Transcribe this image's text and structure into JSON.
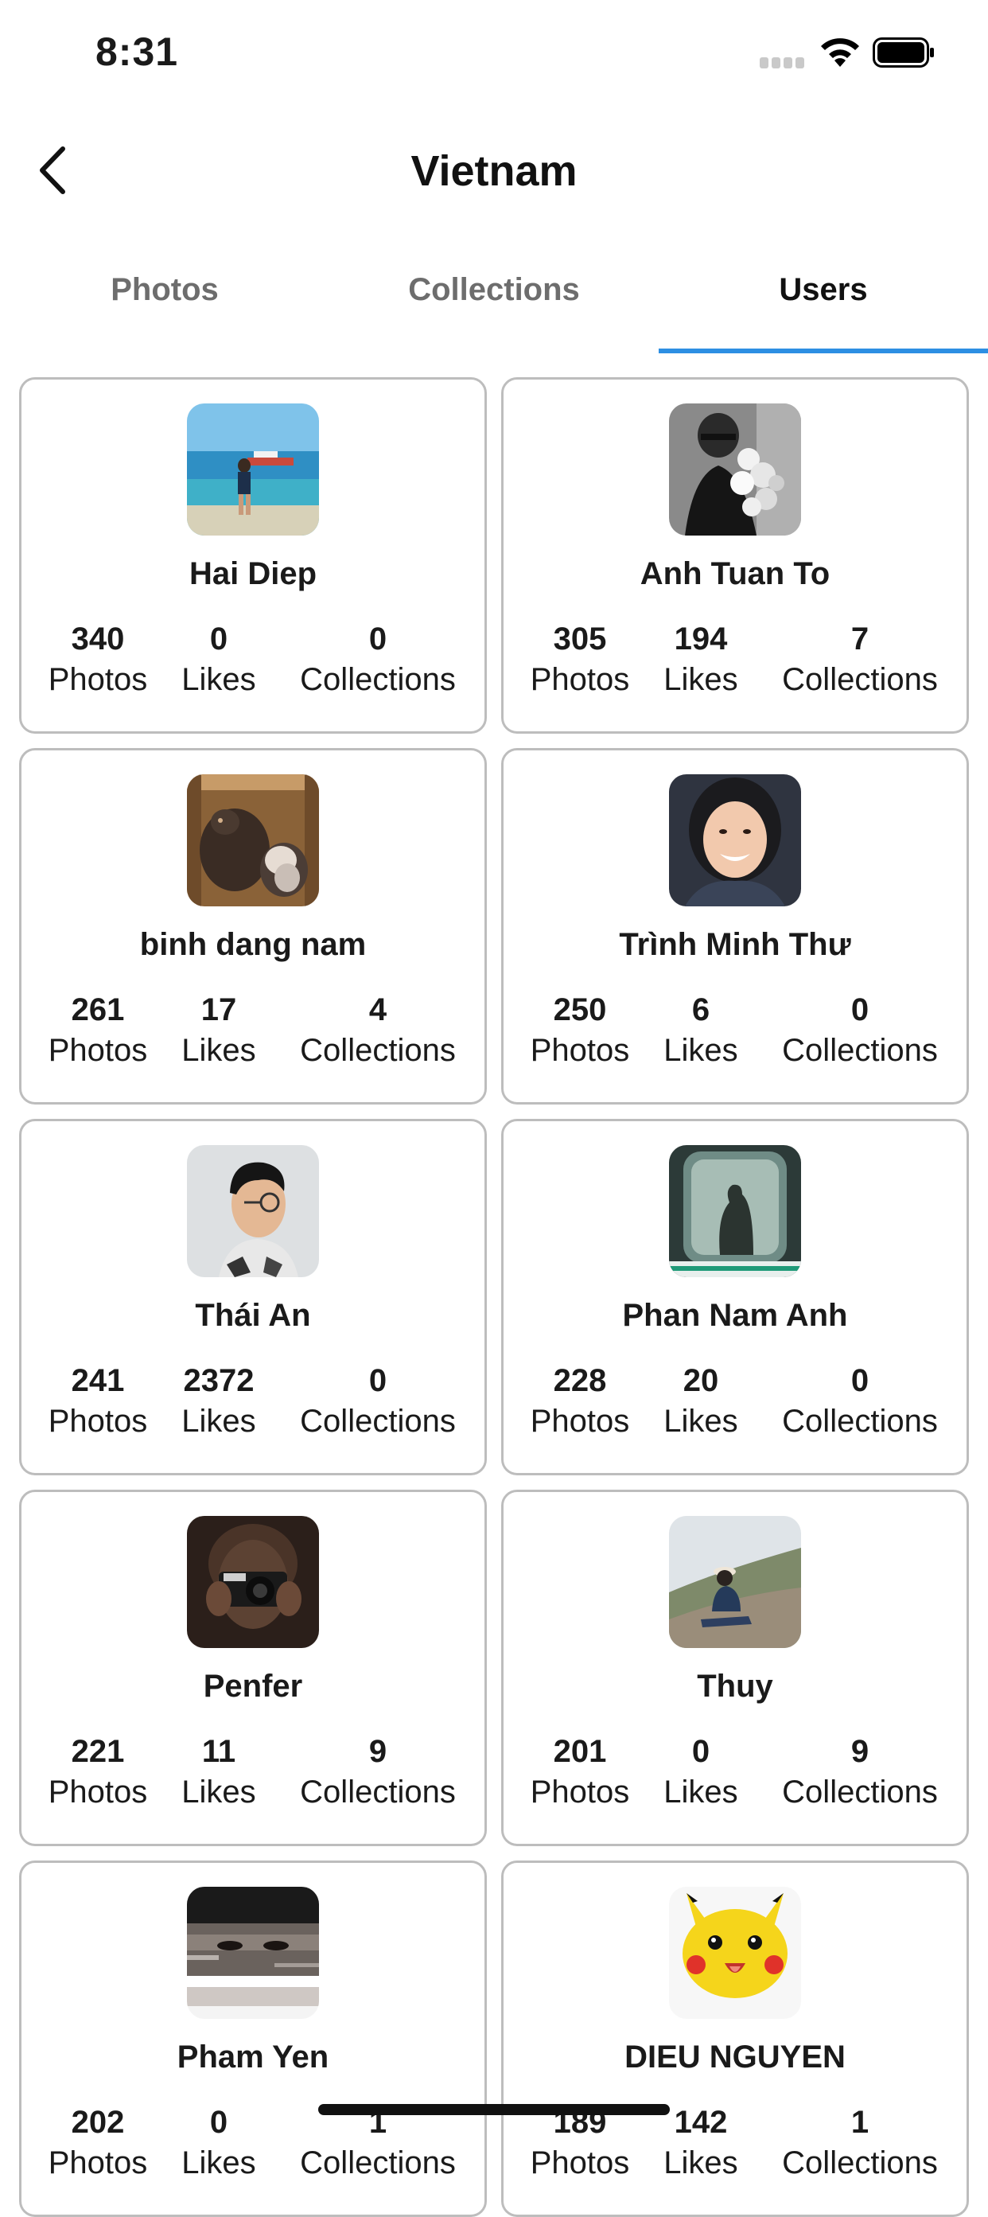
{
  "status_bar": {
    "time": "8:31"
  },
  "nav": {
    "title": "Vietnam"
  },
  "tabs": [
    {
      "label": "Photos",
      "active": false
    },
    {
      "label": "Collections",
      "active": false
    },
    {
      "label": "Users",
      "active": true
    }
  ],
  "colors": {
    "accent": "#2d8fe3",
    "card_border": "#bdbdbd",
    "inactive_tab": "#6d6d6d"
  },
  "users": [
    {
      "name": "Hai Diep",
      "photos": "340",
      "likes": "0",
      "collections": "0",
      "avatar": "beach-photo"
    },
    {
      "name": "Anh Tuan To",
      "photos": "305",
      "likes": "194",
      "collections": "7",
      "avatar": "flowers-bw-photo"
    },
    {
      "name": "binh dang nam",
      "photos": "261",
      "likes": "17",
      "collections": "4",
      "avatar": "pigeons-photo"
    },
    {
      "name": "Trình Minh Thư",
      "photos": "250",
      "likes": "6",
      "collections": "0",
      "avatar": "smiling-girl-photo"
    },
    {
      "name": "Thái An",
      "photos": "241",
      "likes": "2372",
      "collections": "0",
      "avatar": "man-glasses-photo"
    },
    {
      "name": "Phan Nam Anh",
      "photos": "228",
      "likes": "20",
      "collections": "0",
      "avatar": "train-window-photo"
    },
    {
      "name": "Penfer",
      "photos": "221",
      "likes": "11",
      "collections": "9",
      "avatar": "camera-photo"
    },
    {
      "name": "Thuy",
      "photos": "201",
      "likes": "0",
      "collections": "9",
      "avatar": "hillside-photo"
    },
    {
      "name": "Pham Yen",
      "photos": "202",
      "likes": "0",
      "collections": "1",
      "avatar": "eyes-photo"
    },
    {
      "name": "DIEU NGUYEN",
      "photos": "189",
      "likes": "142",
      "collections": "1",
      "avatar": "pixel-pikachu"
    }
  ],
  "labels": {
    "photos": "Photos",
    "likes": "Likes",
    "collections": "Collections"
  }
}
